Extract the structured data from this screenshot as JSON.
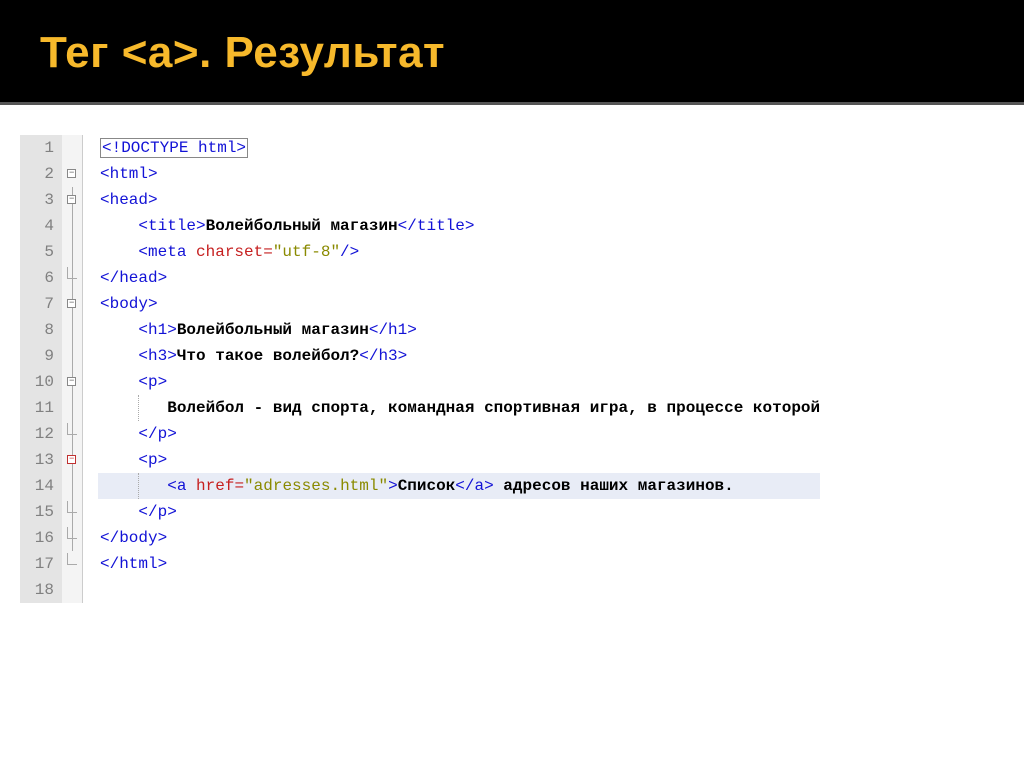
{
  "header": {
    "title": "Тег <a>. Результат"
  },
  "code": {
    "line1": {
      "tag": "<!DOCTYPE html>"
    },
    "line2": {
      "tag_open": "<html>"
    },
    "line3": {
      "tag_open": "<head>"
    },
    "line4": {
      "open": "<title>",
      "text": "Волейбольный магазин",
      "close": "</title>"
    },
    "line5": {
      "open": "<meta ",
      "attr": "charset=",
      "val": "\"utf-8\"",
      "close": "/>"
    },
    "line6": {
      "close": "</head>"
    },
    "line7": {
      "open": "<body>"
    },
    "line8": {
      "open": "<h1>",
      "text": "Волейбольный магазин",
      "close": "</h1>"
    },
    "line9": {
      "open": "<h3>",
      "text": "Что такое волейбол?",
      "close": "</h3>"
    },
    "line10": {
      "open": "<p>"
    },
    "line11": {
      "text": "Волейбол - вид спорта, командная спортивная игра, в процессе которой"
    },
    "line12": {
      "close": "</p>"
    },
    "line13": {
      "open": "<p>"
    },
    "line14": {
      "open": "<a ",
      "attr": "href=",
      "val": "\"adresses.html\"",
      "mid": ">",
      "text1": "Список",
      "aclose": "</a>",
      "text2": " адресов наших магазинов."
    },
    "line15": {
      "close": "</p>"
    },
    "line16": {
      "close": "</body>"
    },
    "line17": {
      "close": "</html>"
    }
  },
  "linenums": {
    "l1": "1",
    "l2": "2",
    "l3": "3",
    "l4": "4",
    "l5": "5",
    "l6": "6",
    "l7": "7",
    "l8": "8",
    "l9": "9",
    "l10": "10",
    "l11": "11",
    "l12": "12",
    "l13": "13",
    "l14": "14",
    "l15": "15",
    "l16": "16",
    "l17": "17",
    "l18": "18"
  }
}
